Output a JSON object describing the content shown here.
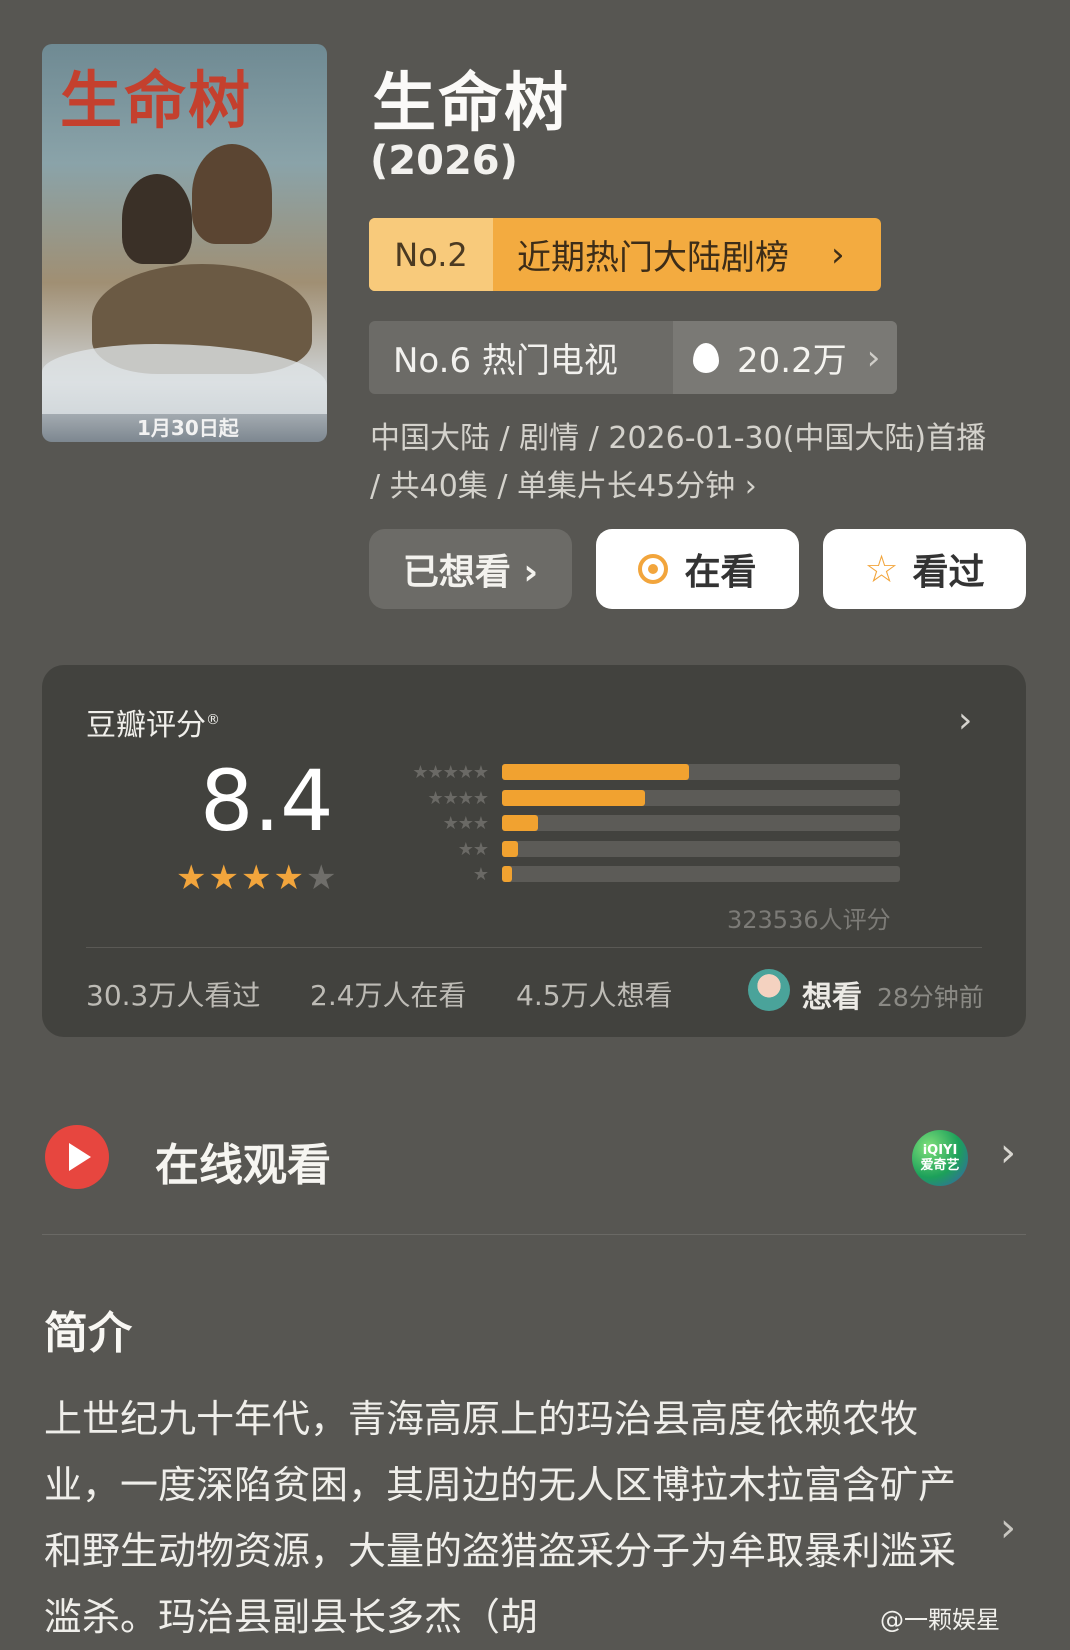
{
  "poster": {
    "title": "生命树",
    "date": "1月30日起"
  },
  "show": {
    "title": "生命树",
    "year": "(2026)"
  },
  "rank_primary": {
    "no": "No.2",
    "name": "近期热门大陆剧榜",
    "chevron": "›"
  },
  "rank_secondary": {
    "label": "No.6 热门电视",
    "heat": "20.2万",
    "chevron": "›"
  },
  "meta": {
    "text": "中国大陆 / 剧情 / 2026-01-30(中国大陆)首播 / 共40集 / 单集片长45分钟 ›"
  },
  "actions": {
    "wanted": "已想看 ›",
    "watching": "在看",
    "watched": "看过"
  },
  "rating": {
    "label": "豆瓣评分",
    "registered": "®",
    "score": "8.4",
    "stars_filled": 4,
    "stars_total": 5,
    "distribution": [
      {
        "stars": "★★★★★",
        "fraction": 0.47
      },
      {
        "stars": "★★★★",
        "fraction": 0.36
      },
      {
        "stars": "★★★",
        "fraction": 0.09
      },
      {
        "stars": "★★",
        "fraction": 0.04
      },
      {
        "stars": "★",
        "fraction": 0.025
      }
    ],
    "count": "323536人评分",
    "stats": {
      "watched": "30.3万人看过",
      "watching": "2.4万人在看",
      "wanted": "4.5万人想看"
    },
    "recent": {
      "action": "想看",
      "time": "28分钟前"
    }
  },
  "online": {
    "title": "在线观看",
    "provider_line1": "iQIYI",
    "provider_line2": "爱奇艺"
  },
  "intro": {
    "title": "简介",
    "text": "上世纪九十年代，青海高原上的玛治县高度依赖农牧业，一度深陷贫困，其周边的无人区博拉木拉富含矿产和野生动物资源，大量的盗猎盗采分子为牟取暴利滥采滥杀。玛治县副县长多杰（胡"
  },
  "watermark": "@一颗娱星",
  "colors": {
    "background": "#575652",
    "accent_orange": "#f3ab40",
    "play_red": "#e7463f",
    "card_dark": "#42423e"
  }
}
